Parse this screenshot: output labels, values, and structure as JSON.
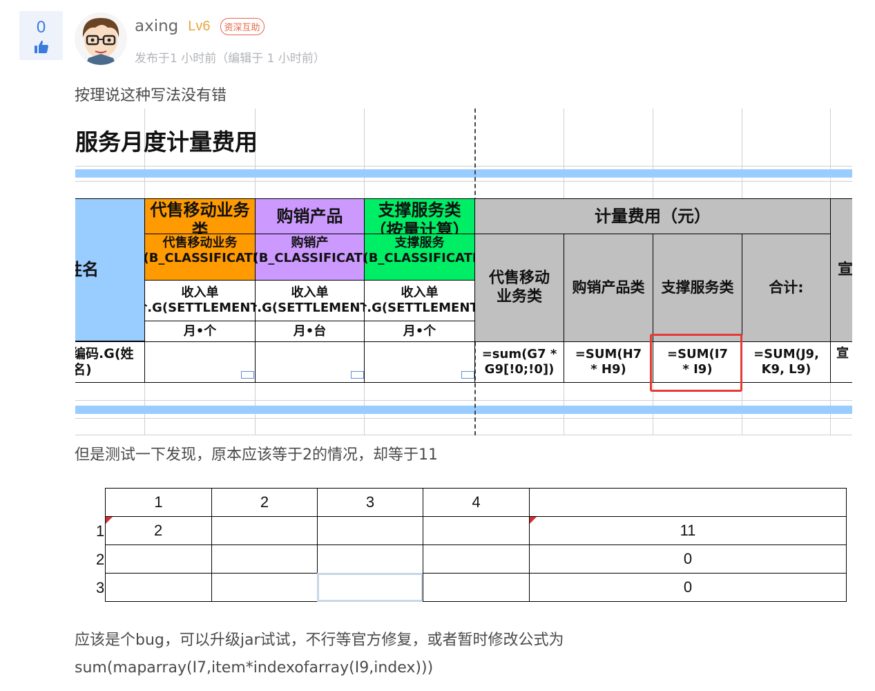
{
  "vote": {
    "count": "0",
    "icon": "thumbs-up-icon"
  },
  "post": {
    "author": "axing",
    "level": "Lv6",
    "badge": "资深互助",
    "meta": "发布于1 小时前（编辑于 1 小时前）",
    "text1": "按理说这种写法没有错",
    "text2": "但是测试一下发现，原本应该等于2的情况，却等于11",
    "text3": "应该是个bug，可以升级jar试试，不行等官方修复，或者暂时修改公式为",
    "text4": "sum(maparray(I7,item*indexofarray(I9,index)))"
  },
  "sheet1": {
    "title": "服务月度计量费用",
    "col_name": "姓名",
    "h_mobile": "代售移动业务类",
    "h_sales": "购销产品",
    "h_support": "支撑服务类（按量计算）",
    "m_mobile": "代售移动业务类.G(B_CLASSIFICATION)",
    "m_sales": "购销产品.G(B_CLASSIFICATION)",
    "m_support": "支撑服务类.G(B_CLASSIFICATION)",
    "price_label": "收入单价.G(SETTLEMENT_",
    "unit_mobile": "月•个",
    "unit_sales": "月•台",
    "unit_support": "月•个",
    "fee_header": "计量费用（元）",
    "fee_mobile": "代售移动业务类",
    "fee_sales": "购销产品类",
    "fee_support": "支撑服务类",
    "fee_total": "合计:",
    "extra_header": "宣",
    "row_name": "编码.G(姓名)",
    "f_g": "=sum(G7 * G9[!0;!0])",
    "f_h": "=SUM(H7 * H9)",
    "f_i": "=SUM(I7 * I9)",
    "f_total": "=SUM(J9, K9, L9)",
    "extra_cell": "宣",
    "colors": {
      "orange": "#ff9a00",
      "purple": "#cc99ff",
      "green": "#00ee66",
      "gray": "#c0c0c0",
      "blue": "#99ccff",
      "highlight": "#e53a35"
    }
  },
  "sheet2": {
    "headers": [
      "1",
      "2",
      "3",
      "4"
    ],
    "rows": [
      {
        "label": "1",
        "c1": "2",
        "result": "11"
      },
      {
        "label": "2",
        "c1": "",
        "result": "0"
      },
      {
        "label": "3",
        "c1": "",
        "result": "0"
      }
    ]
  }
}
